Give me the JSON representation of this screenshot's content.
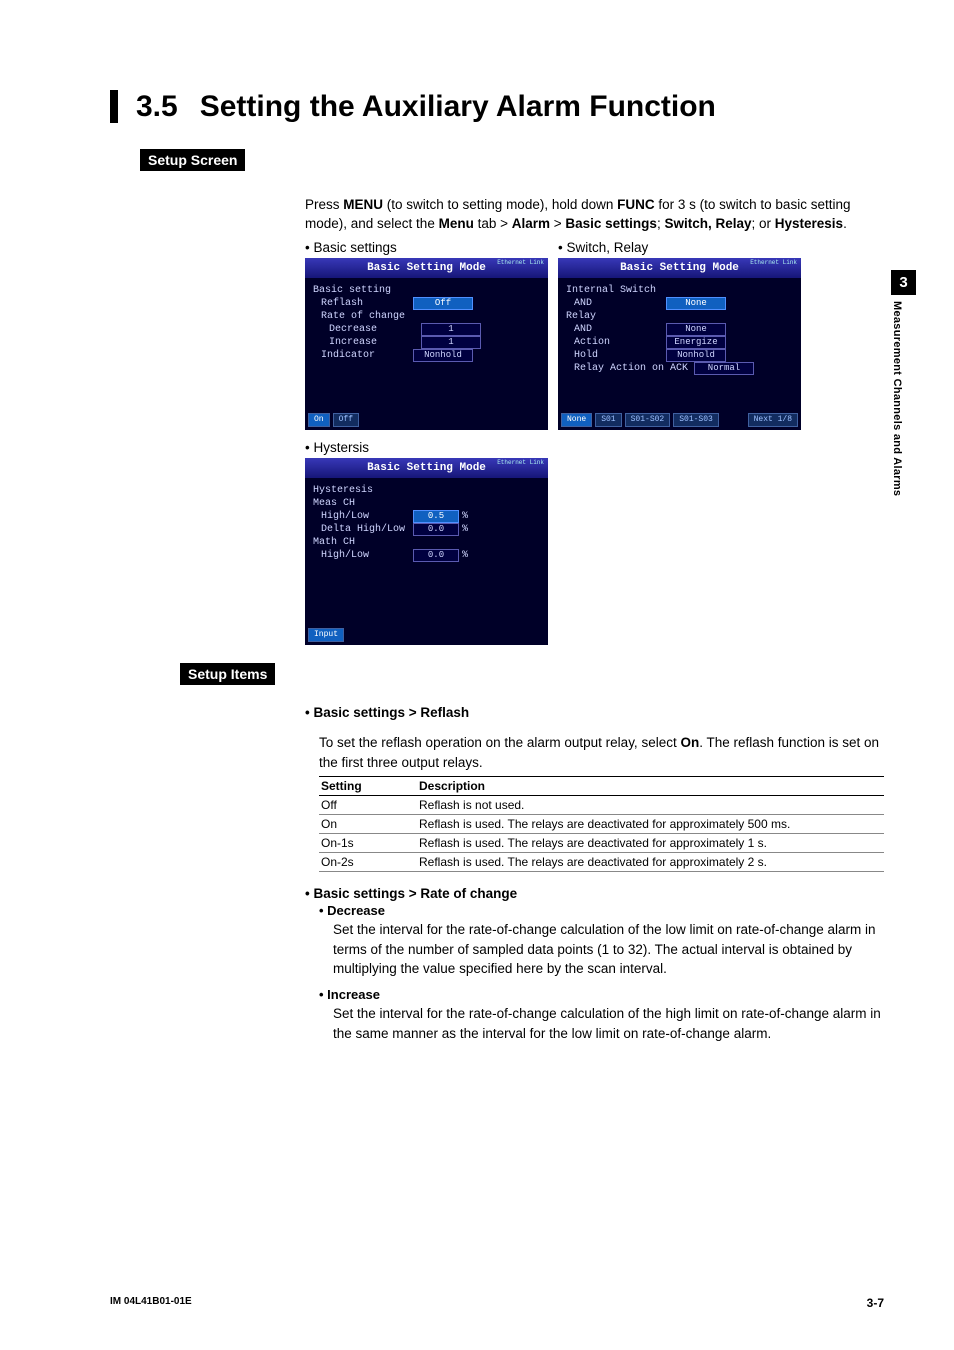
{
  "sideTab": {
    "chapter": "3",
    "text": "Measurement Channels and Alarms"
  },
  "title": {
    "number": "3.5",
    "text": "Setting the Auxiliary Alarm Function"
  },
  "setupScreen": {
    "label": "Setup Screen",
    "intro_parts": {
      "p1": "Press ",
      "b1": "MENU",
      "p2": " (to switch to setting mode), hold down ",
      "b2": "FUNC",
      "p3": " for 3 s (to switch to basic setting mode), and select the ",
      "b3": "Menu",
      "p4": " tab > ",
      "b4": "Alarm",
      "p5": " > ",
      "b5": "Basic settings",
      "p6": "; ",
      "b6": "Switch, Relay",
      "p7": "; or ",
      "b7": "Hysteresis",
      "p8": "."
    },
    "captions": {
      "basic": "• Basic settings",
      "switch": "• Switch, Relay",
      "hyst": "• Hystersis"
    },
    "screens": {
      "headerTitle": "Basic Setting Mode",
      "ethernet": "Ethernet\nLink",
      "basic": {
        "heading": "Basic setting",
        "rows": [
          {
            "label": "Reflash",
            "value": "Off",
            "sel": true
          },
          {
            "label": "Rate of change",
            "value": ""
          },
          {
            "label": "Decrease",
            "value": "1",
            "indent": true
          },
          {
            "label": "Increase",
            "value": "1",
            "indent": true
          },
          {
            "label": "Indicator",
            "value": "Nonhold"
          }
        ],
        "footer": [
          {
            "t": "On",
            "sel": true
          },
          {
            "t": "Off"
          }
        ]
      },
      "switch": {
        "heading": "Internal Switch",
        "rows1": [
          {
            "label": "AND",
            "value": "None",
            "sel": true
          }
        ],
        "heading2": "Relay",
        "rows2": [
          {
            "label": "AND",
            "value": "None"
          },
          {
            "label": "Action",
            "value": "Energize"
          },
          {
            "label": "Hold",
            "value": "Nonhold"
          },
          {
            "label": "Relay Action on ACK",
            "value": "Normal"
          }
        ],
        "footer": [
          {
            "t": "None",
            "sel": true
          },
          {
            "t": "S01"
          },
          {
            "t": "S01-S02"
          },
          {
            "t": "S01-S03"
          },
          {
            "t": "Next 1/8",
            "right": true
          }
        ]
      },
      "hyst": {
        "heading": "Hysteresis",
        "sub1": "Meas CH",
        "rows1": [
          {
            "label": "High/Low",
            "value": "0.5",
            "unit": "%",
            "sel": true
          },
          {
            "label": "Delta High/Low",
            "value": "0.0",
            "unit": "%"
          }
        ],
        "sub2": "Math CH",
        "rows2": [
          {
            "label": "High/Low",
            "value": "0.0",
            "unit": "%"
          }
        ],
        "footer": [
          {
            "t": "Input",
            "sel": true
          }
        ]
      }
    }
  },
  "setupItems": {
    "label": "Setup Items",
    "reflash": {
      "heading": "Basic settings > Reflash",
      "body_parts": {
        "p1": "To set the reflash operation on the alarm output relay, select ",
        "b1": "On",
        "p2": ". The reflash function is set on the first three output relays."
      },
      "table": {
        "headers": [
          "Setting",
          "Description"
        ],
        "rows": [
          [
            "Off",
            "Reflash is not used."
          ],
          [
            "On",
            "Reflash is used. The relays are deactivated for approximately 500 ms."
          ],
          [
            "On-1s",
            "Reflash is used. The relays are deactivated for approximately 1 s."
          ],
          [
            "On-2s",
            "Reflash is used. The relays are deactivated for approximately 2 s."
          ]
        ]
      }
    },
    "rateOfChange": {
      "heading": "Basic settings > Rate of change",
      "decrease": {
        "title": "Decrease",
        "body": "Set the interval for the rate-of-change calculation of the low limit on rate-of-change alarm in terms of the number of sampled data points (1 to 32). The actual interval is obtained by multiplying the value specified here by the scan interval."
      },
      "increase": {
        "title": "Increase",
        "body": "Set the interval for the rate-of-change calculation of the high limit on rate-of-change alarm in the same manner as the interval for the low limit on rate-of-change alarm."
      }
    }
  },
  "footer": {
    "left": "IM 04L41B01-01E",
    "right": "3-7"
  }
}
